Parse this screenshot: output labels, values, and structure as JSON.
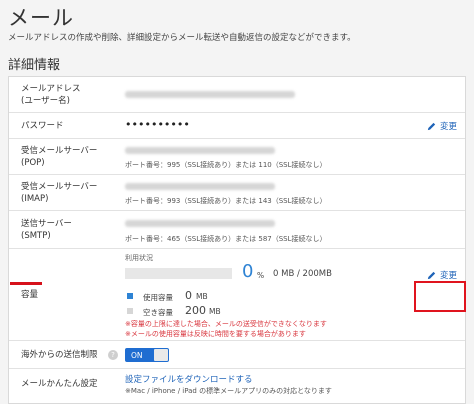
{
  "header": {
    "title": "メール",
    "description": "メールアドレスの作成や削除、詳細設定からメール転送や自動返信の設定などができます。",
    "section_title": "詳細情報"
  },
  "rows": {
    "address": {
      "label_line1": "メールアドレス",
      "label_line2": "(ユーザー名)"
    },
    "password": {
      "label": "パスワード",
      "value": "••••••••••",
      "edit": "変更"
    },
    "pop": {
      "label_line1": "受信メールサーバー",
      "label_line2": "(POP)",
      "note_prefix": "ポート番号：995（SSL接続あり）または 110（SSL接続なし）"
    },
    "imap": {
      "label_line1": "受信メールサーバー",
      "label_line2": "(IMAP)",
      "note_prefix": "ポート番号：993（SSL接続あり）または 143（SSL接続なし）"
    },
    "smtp": {
      "label_line1": "送信サーバー",
      "label_line2": "(SMTP)",
      "note_prefix": "ポート番号：465（SSL接続あり）または 587（SSL接続なし）"
    },
    "capacity": {
      "label": "容量",
      "usage_title": "利用状況",
      "percent": "0",
      "percent_unit": "%",
      "total": "0 MB / 200MB",
      "used_label": "使用容量",
      "used_value": "0",
      "used_unit": "MB",
      "free_label": "空き容量",
      "free_value": "200",
      "free_unit": "MB",
      "warning1": "※容量の上限に達した場合、メールの送受信ができなくなります",
      "warning2": "※メールの使用容量は反映に時間を要する場合があります",
      "edit": "変更",
      "usage_fraction": 0
    },
    "overseas": {
      "label": "海外からの送信制限",
      "toggle": "ON",
      "help": "?"
    },
    "easy_setup": {
      "label": "メールかんたん設定",
      "link": "設定ファイルをダウンロードする",
      "note": "※Mac / iPhone / iPad の標準メールアプリのみの対応となります"
    }
  },
  "colors": {
    "accent": "#1e63b8",
    "toggle": "#1f6dd1",
    "percent": "#2e83d4",
    "used_square": "#2e83d4",
    "free_square": "#d6d6d6",
    "warning": "#d9363e",
    "highlight": "#e0141e"
  },
  "icons": {
    "edit": "pencil-icon",
    "help": "question-icon"
  }
}
